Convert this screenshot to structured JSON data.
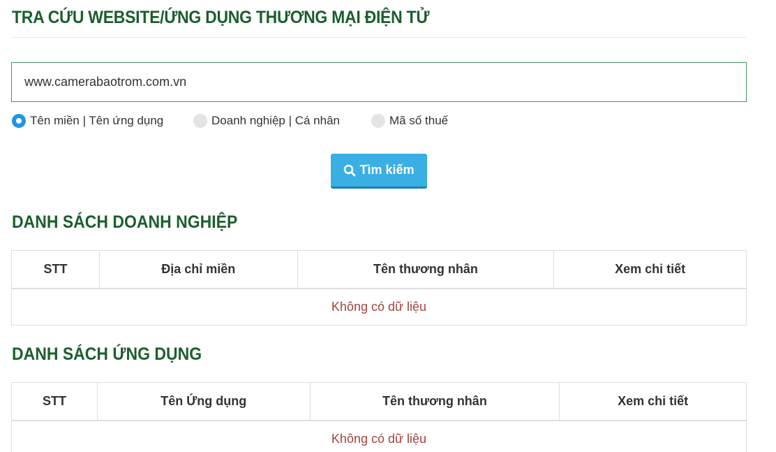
{
  "header": {
    "title": "TRA CỨU WEBSITE/ỨNG DỤNG THƯƠNG MẠI ĐIỆN TỬ"
  },
  "search": {
    "value": "www.camerabaotrom.com.vn",
    "button_label": "Tìm kiếm",
    "button_icon": "search-icon",
    "options": [
      {
        "label": "Tên miền | Tên ứng dụng",
        "checked": true
      },
      {
        "label": "Doanh nghiệp | Cá nhân",
        "checked": false
      },
      {
        "label": "Mã số thuế",
        "checked": false
      }
    ]
  },
  "businesses": {
    "title": "DANH SÁCH DOANH NGHIỆP",
    "columns": [
      "STT",
      "Địa chỉ miền",
      "Tên thương nhân",
      "Xem chi tiết"
    ],
    "empty_text": "Không có dữ liệu"
  },
  "apps": {
    "title": "DANH SÁCH ỨNG DỤNG",
    "columns": [
      "STT",
      "Tên Ứng dụng",
      "Tên thương nhân",
      "Xem chi tiết"
    ],
    "empty_text": "Không có dữ liệu"
  },
  "colors": {
    "heading": "#1b5e2c",
    "input_border": "#3e9b5a",
    "button": "#3aafe3",
    "radio_checked": "#2196e0",
    "empty_text": "#a0443f"
  }
}
